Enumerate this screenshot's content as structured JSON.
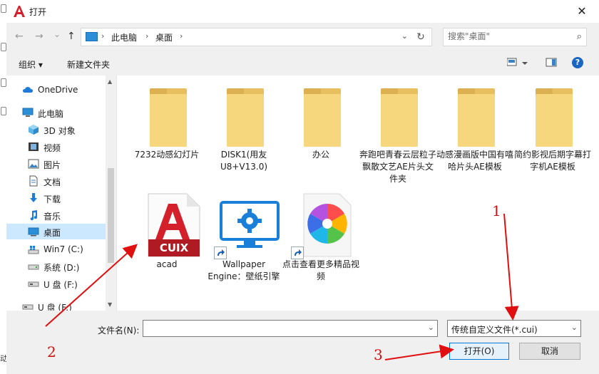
{
  "window": {
    "title": "打开",
    "close_glyph": "✕"
  },
  "background_app": {
    "visible_text": "动"
  },
  "navigation": {
    "back_glyph": "←",
    "forward_glyph": "→",
    "recent_glyph": "⌄",
    "up_glyph": "↑",
    "address": {
      "crumbs": [
        "此电脑",
        "桌面"
      ],
      "separator": "›",
      "dropdown_glyph": "⌄"
    },
    "refresh_glyph": "↻",
    "search": {
      "placeholder": "搜索\"桌面\"",
      "icon": "search-icon",
      "glyph": "⌕"
    }
  },
  "toolbar": {
    "organize": "组织 ▾",
    "new_folder": "新建文件夹",
    "help": "?"
  },
  "sidebar": {
    "items": [
      {
        "label": "OneDrive",
        "icon": "cloud-icon"
      },
      {
        "label": "此电脑",
        "icon": "computer-icon"
      },
      {
        "label": "3D 对象",
        "icon": "cube-icon"
      },
      {
        "label": "视频",
        "icon": "video-icon"
      },
      {
        "label": "图片",
        "icon": "picture-icon"
      },
      {
        "label": "文档",
        "icon": "document-icon"
      },
      {
        "label": "下载",
        "icon": "download-icon"
      },
      {
        "label": "音乐",
        "icon": "music-icon"
      },
      {
        "label": "桌面",
        "icon": "desktop-icon",
        "selected": true
      },
      {
        "label": "Win7 (C:)",
        "icon": "windows-drive-icon"
      },
      {
        "label": "系统 (D:)",
        "icon": "drive-icon"
      },
      {
        "label": "U 盘 (F:)",
        "icon": "usb-drive-icon"
      },
      {
        "label": "U 盘 (F:)",
        "icon": "usb-drive-icon"
      }
    ]
  },
  "files": [
    {
      "name": "7232动感幻灯片",
      "kind": "folder"
    },
    {
      "name": "DISK1(用友U8+V13.0)",
      "kind": "folder"
    },
    {
      "name": "办公",
      "kind": "folder"
    },
    {
      "name": "奔跑吧青春云层粒子飘散文艺AE片头文件夹",
      "kind": "folder"
    },
    {
      "name": "动感漫画版中国有嘻哈片头AE模板",
      "kind": "folder"
    },
    {
      "name": "简约影视后期字幕打字机AE模板",
      "kind": "folder"
    },
    {
      "name": "acad",
      "kind": "cuix",
      "badge": "CUIX"
    },
    {
      "name": "Wallpaper Engine：壁纸引擎",
      "kind": "shortcut"
    },
    {
      "name": "点击查看更多精品视频",
      "kind": "shortcut"
    }
  ],
  "footer": {
    "filename_label": "文件名(N):",
    "filename_value": "",
    "file_type": "传统自定义文件(*.cui)",
    "open_button": "打开(O)",
    "cancel_button": "取消"
  },
  "annotations": [
    "1",
    "2",
    "3"
  ],
  "colors": {
    "annotation_red": "#e01010",
    "accent_blue": "#0078d7",
    "selection": "#cce8ff",
    "folder": "#f7d77e"
  }
}
